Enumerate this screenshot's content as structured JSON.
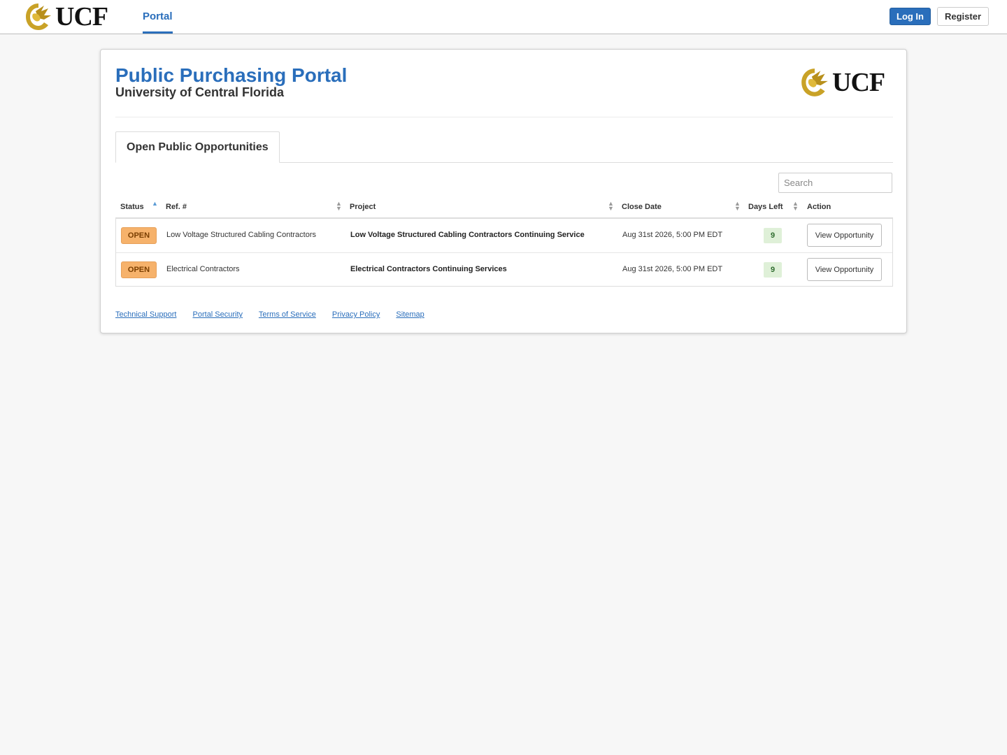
{
  "navbar": {
    "logo_text": "UCF",
    "active_nav": "Portal",
    "login_label": "Log In",
    "register_label": "Register"
  },
  "header": {
    "title": "Public Purchasing Portal",
    "subtitle": "University of Central Florida",
    "logo_text": "UCF"
  },
  "tabs": [
    {
      "label": "Open Public Opportunities",
      "active": true
    }
  ],
  "search": {
    "placeholder": "Search",
    "value": ""
  },
  "table": {
    "columns": {
      "status": "Status",
      "ref": "Ref. #",
      "project": "Project",
      "close_date": "Close Date",
      "days_left": "Days Left",
      "action": "Action"
    },
    "sort": {
      "column": "Status",
      "direction": "ascending"
    },
    "rows": [
      {
        "status": "OPEN",
        "ref": "Low Voltage Structured Cabling Contractors",
        "project": "Low Voltage Structured Cabling Contractors Continuing Service",
        "close_date": "Aug 31st 2026, 5:00 PM EDT",
        "days_left": "9",
        "action": "View Opportunity"
      },
      {
        "status": "OPEN",
        "ref": "Electrical Contractors",
        "project": "Electrical Contractors Continuing Services",
        "close_date": "Aug 31st 2026, 5:00 PM EDT",
        "days_left": "9",
        "action": "View Opportunity"
      }
    ]
  },
  "footer": {
    "links": [
      "Technical Support",
      "Portal Security",
      "Terms of Service",
      "Privacy Policy",
      "Sitemap"
    ]
  },
  "colors": {
    "brand_blue": "#2a6ebb",
    "ucf_gold": "#c9a227",
    "open_badge": "#f6b26b",
    "days_badge": "#dff0d8"
  }
}
